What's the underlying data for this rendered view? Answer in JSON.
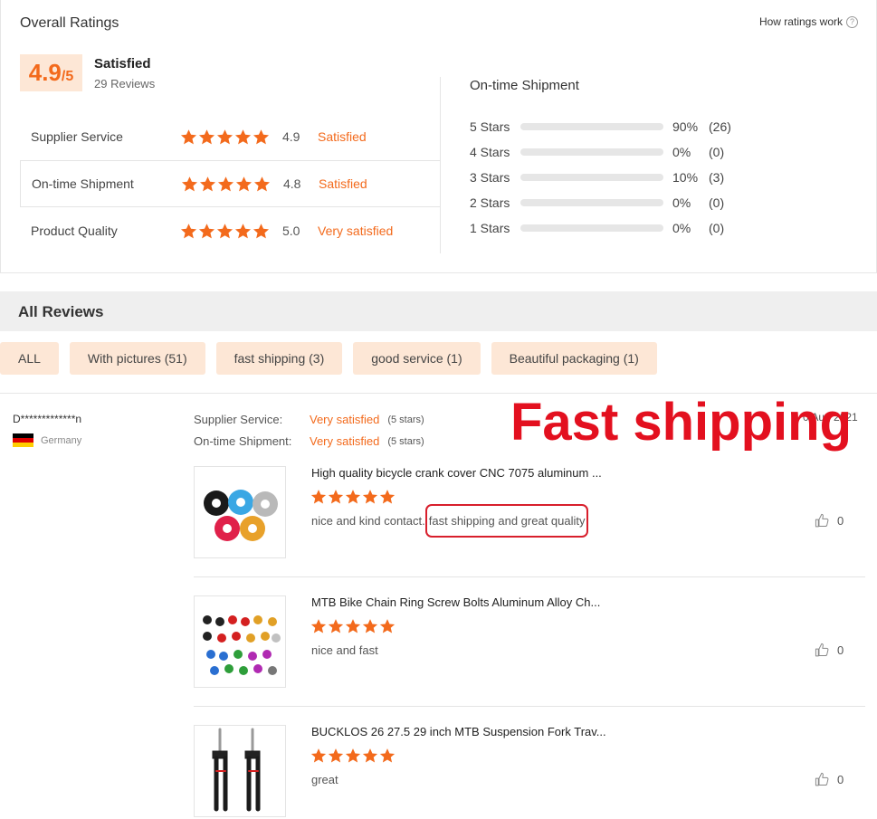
{
  "summary": {
    "title": "Overall Ratings",
    "how_link": "How ratings work",
    "score": "4.9",
    "score_denominator": "/5",
    "label": "Satisfied",
    "reviews": "29 Reviews"
  },
  "ratings": [
    {
      "label": "Supplier Service",
      "score": "4.9",
      "word": "Satisfied",
      "stars": 5
    },
    {
      "label": "On-time Shipment",
      "score": "4.8",
      "word": "Satisfied",
      "stars": 5
    },
    {
      "label": "Product Quality",
      "score": "5.0",
      "word": "Very satisfied",
      "stars": 5
    }
  ],
  "distribution": {
    "title": "On-time Shipment",
    "rows": [
      {
        "label": "5 Stars",
        "fraction": 0.9,
        "pct": "90%",
        "count": "(26)"
      },
      {
        "label": "4 Stars",
        "fraction": 0.0,
        "pct": "0%",
        "count": "(0)"
      },
      {
        "label": "3 Stars",
        "fraction": 0.1,
        "pct": "10%",
        "count": "(3)"
      },
      {
        "label": "2 Stars",
        "fraction": 0.0,
        "pct": "0%",
        "count": "(0)"
      },
      {
        "label": "1 Stars",
        "fraction": 0.0,
        "pct": "0%",
        "count": "(0)"
      }
    ]
  },
  "all_reviews": {
    "title": "All Reviews",
    "filters": [
      "ALL",
      "With pictures (51)",
      "fast shipping (3)",
      "good service (1)",
      "Beautiful packaging (1)"
    ]
  },
  "review": {
    "reviewer": "D*************n",
    "country": "Germany",
    "date": "0 Aug 2021",
    "supplier_service_key": "Supplier Service:",
    "supplier_service_value": "Very satisfied",
    "supplier_service_stars": "(5 stars)",
    "shipment_key": "On-time Shipment:",
    "shipment_value": "Very satisfied",
    "shipment_stars": "(5 stars)"
  },
  "overlay_text": "Fast shipping",
  "items": [
    {
      "title": "High quality bicycle crank cover CNC 7075 aluminum ...",
      "comment_a": "nice and kind contact.",
      "comment_b": "fast shipping and great quality",
      "likes": "0",
      "stars": 5
    },
    {
      "title": "MTB Bike Chain Ring Screw Bolts Aluminum Alloy Ch...",
      "comment": "nice and fast",
      "likes": "0",
      "stars": 5
    },
    {
      "title": "BUCKLOS 26 27.5 29 inch MTB Suspension Fork Trav...",
      "comment": "great",
      "likes": "0",
      "stars": 5
    }
  ],
  "colors": {
    "accent": "#f36a1c",
    "chip_bg": "#fde7d6",
    "overlay": "#e3101f"
  },
  "icons": {
    "star": "star-icon",
    "like": "thumbs-up-icon",
    "help": "question-circle-icon"
  }
}
